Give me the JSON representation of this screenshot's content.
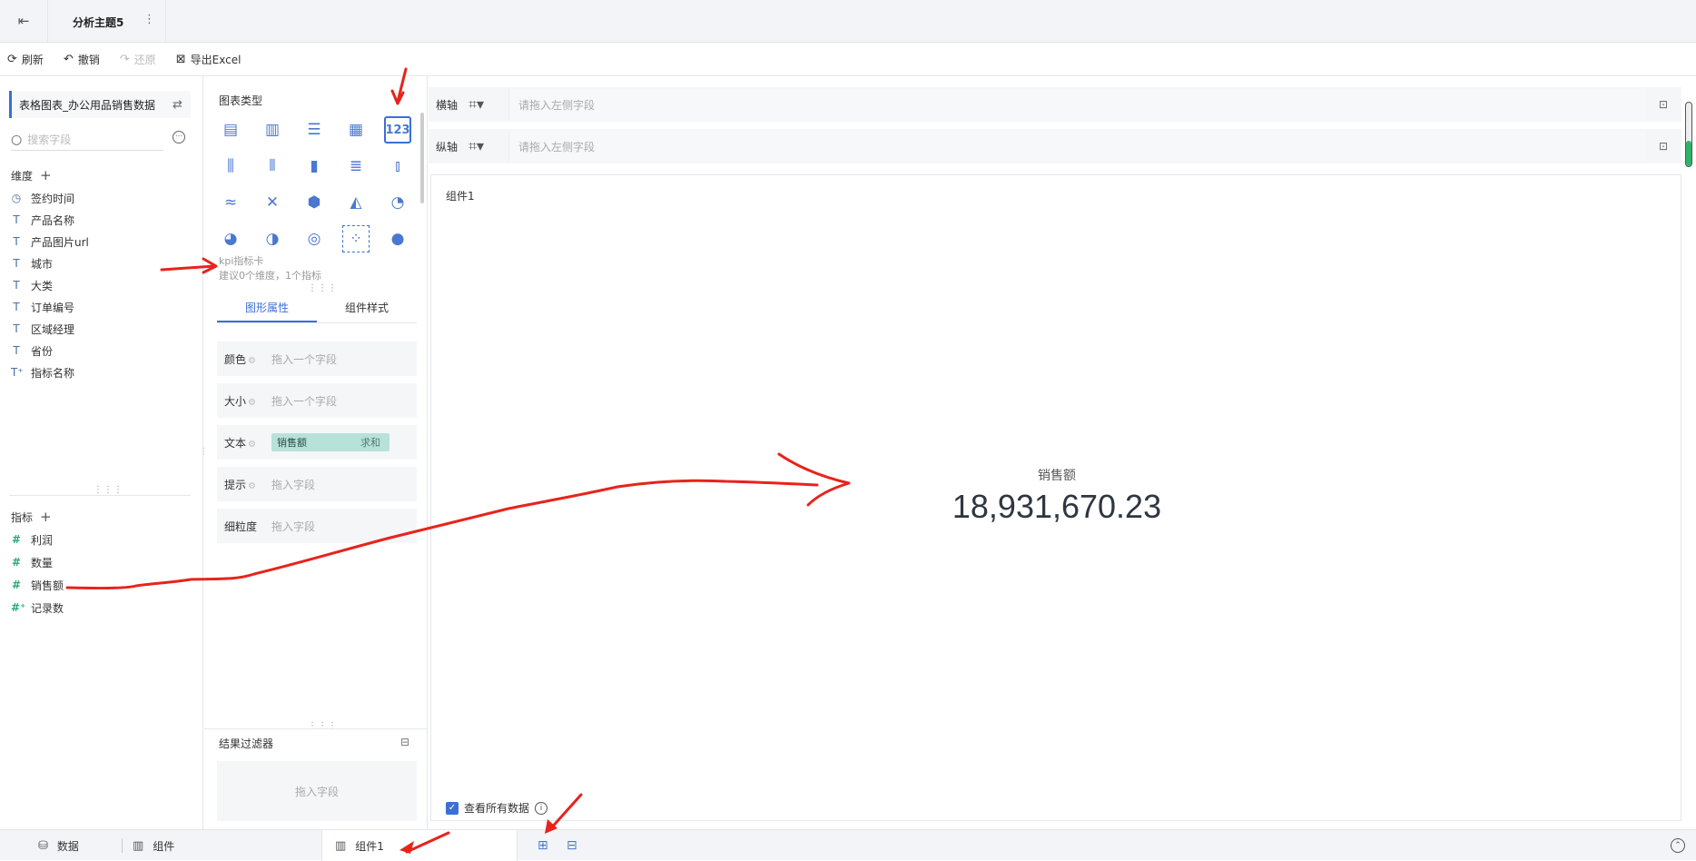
{
  "topbar": {
    "back_icon": "exit-icon",
    "title": "分析主题5",
    "more": "⋮"
  },
  "toolbar": {
    "refresh": "刷新",
    "undo": "撤销",
    "redo": "还原",
    "export": "导出Excel"
  },
  "left": {
    "dataset": "表格图表_办公用品销售数据",
    "search_placeholder": "搜索字段",
    "dimensions_title": "维度",
    "dimensions": [
      {
        "icon": "clock-icon",
        "label": "签约时间"
      },
      {
        "icon": "text-icon",
        "label": "产品名称"
      },
      {
        "icon": "text-icon",
        "label": "产品图片url"
      },
      {
        "icon": "text-icon",
        "label": "城市"
      },
      {
        "icon": "text-icon",
        "label": "大类"
      },
      {
        "icon": "text-icon",
        "label": "订单编号"
      },
      {
        "icon": "text-icon",
        "label": "区域经理"
      },
      {
        "icon": "text-icon",
        "label": "省份"
      },
      {
        "icon": "text-calc-icon",
        "label": "指标名称"
      }
    ],
    "measures_title": "指标",
    "measures": [
      {
        "icon": "hash-icon",
        "label": "利润"
      },
      {
        "icon": "hash-icon",
        "label": "数量"
      },
      {
        "icon": "hash-icon",
        "label": "销售额"
      },
      {
        "icon": "hash-calc-icon",
        "label": "记录数"
      }
    ]
  },
  "middle": {
    "chart_type_title": "图表类型",
    "kpi_card_name": "kpi指标卡",
    "kpi_card_tip": "建议0个维度，1个指标",
    "tabs": [
      "图形属性",
      "组件样式"
    ],
    "props": [
      {
        "label": "颜色",
        "value": "拖入一个字段"
      },
      {
        "label": "大小",
        "value": "拖入一个字段"
      },
      {
        "label": "文本",
        "field": "销售额",
        "agg": "求和"
      },
      {
        "label": "提示",
        "value": "拖入字段"
      },
      {
        "label": "细粒度",
        "value": "拖入字段"
      }
    ],
    "filter_title": "结果过滤器",
    "filter_drop": "拖入字段"
  },
  "axes": {
    "x_label": "横轴",
    "y_label": "纵轴",
    "placeholder": "请拖入左侧字段"
  },
  "canvas": {
    "component_title": "组件1",
    "kpi_label": "销售额",
    "kpi_value": "18,931,670.23",
    "view_all": "查看所有数据"
  },
  "bottom": {
    "data_tab": "数据",
    "component_tab": "组件",
    "active_tab": "组件1"
  },
  "colors": {
    "accent": "#3a6fd8",
    "annotation": "#e8231b",
    "pill": "#b7e2da",
    "scroll_green": "#2fb36b"
  }
}
